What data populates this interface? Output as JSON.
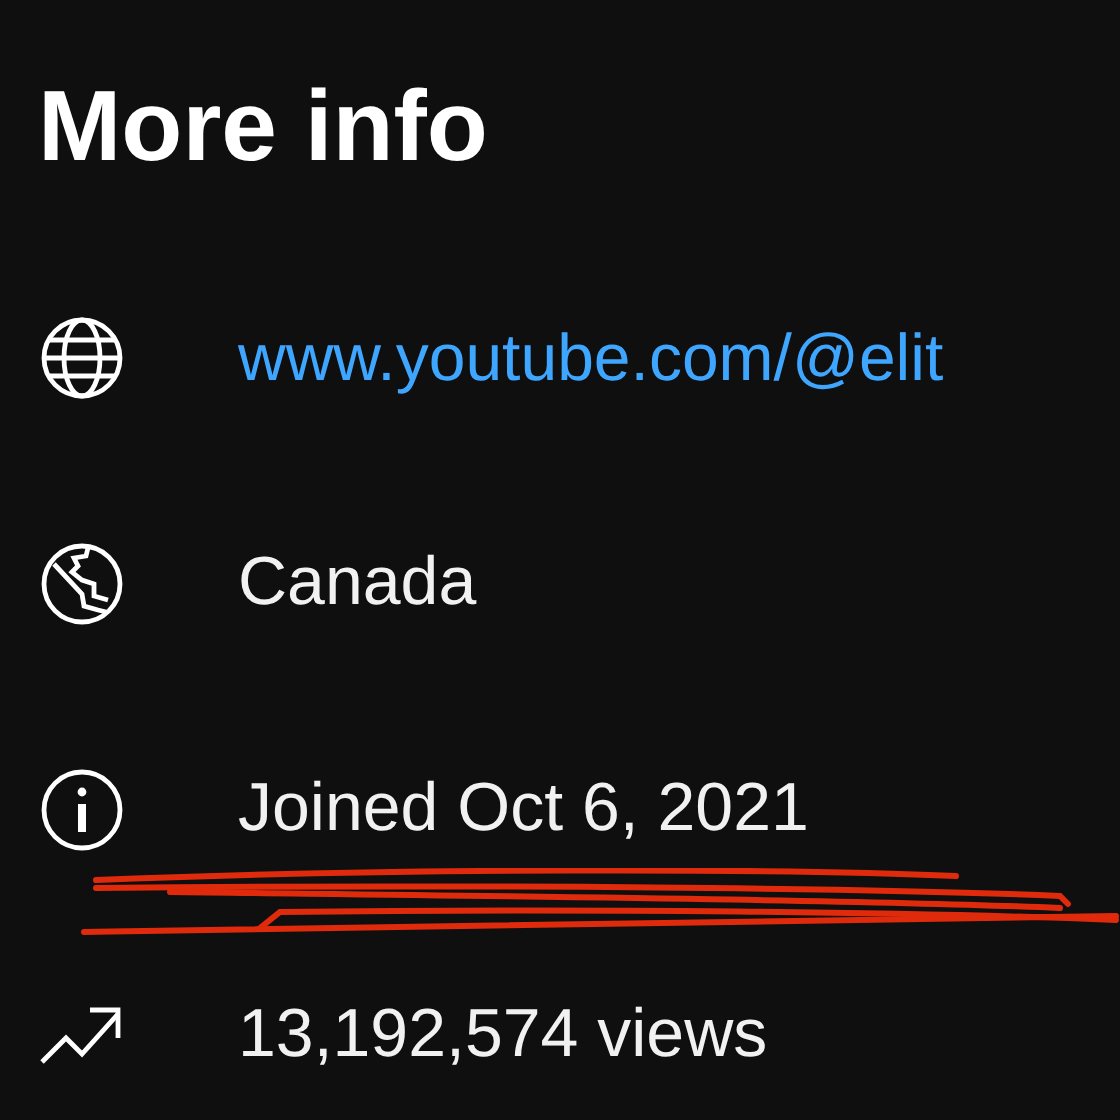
{
  "title": "More info",
  "rows": [
    {
      "kind": "link",
      "text": "www.youtube.com/@elit"
    },
    {
      "kind": "text",
      "text": "Canada"
    },
    {
      "kind": "text",
      "text": "Joined Oct 6, 2021"
    },
    {
      "kind": "text",
      "text": "13,192,574 views"
    }
  ]
}
